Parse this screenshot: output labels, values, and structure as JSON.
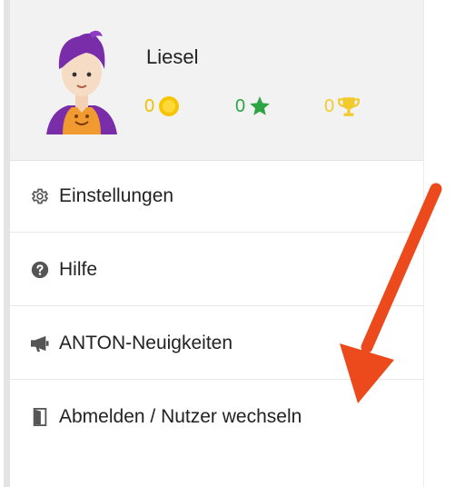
{
  "user": {
    "name": "Liesel",
    "coins": "0",
    "stars": "0",
    "trophies": "0"
  },
  "menu": [
    {
      "label": "Einstellungen",
      "icon": "gear-icon"
    },
    {
      "label": "Hilfe",
      "icon": "help-icon"
    },
    {
      "label": "ANTON-Neuigkeiten",
      "icon": "megaphone-icon"
    },
    {
      "label": "Abmelden / Nutzer wechseln",
      "icon": "door-icon"
    }
  ],
  "colors": {
    "coin": "#f0c000",
    "star": "#2ea544",
    "trophy": "#f3ca2b",
    "arrow": "#ec4a1c",
    "avatar_hair": "#7a2da8",
    "avatar_shirt": "#f19a2f"
  }
}
